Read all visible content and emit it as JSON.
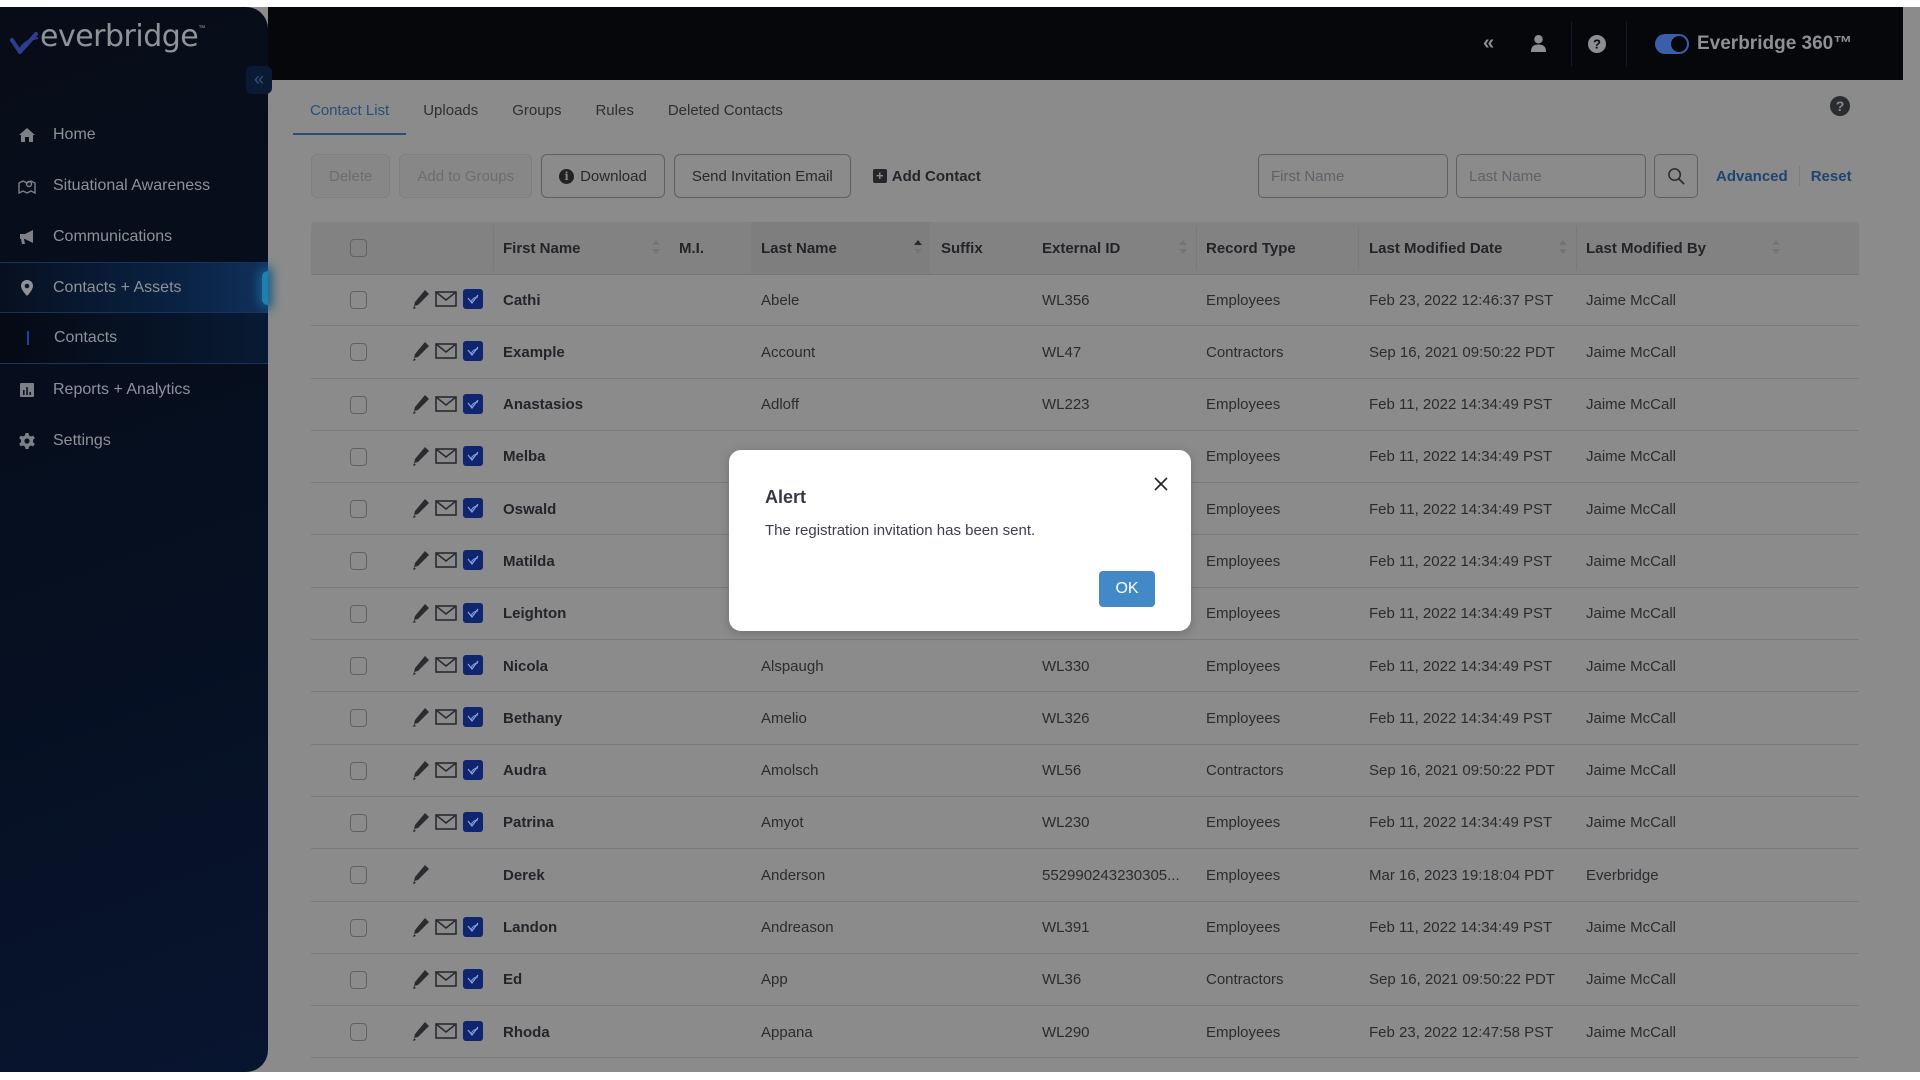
{
  "app": {
    "logo_text": "everbridge",
    "logo_tm": "™",
    "product_label": "Everbridge 360™",
    "product_toggle_on": true,
    "colors": {
      "accent": "#4389c7",
      "link": "#1f4472",
      "app_badge": "#0f2570",
      "toggle": "#3a5fa8"
    }
  },
  "sidebar": {
    "collapse_glyph": "«",
    "items": [
      {
        "label": "Home",
        "icon": "home-icon"
      },
      {
        "label": "Situational Awareness",
        "icon": "map-pin-icon"
      },
      {
        "label": "Communications",
        "icon": "megaphone-icon"
      },
      {
        "label": "Contacts + Assets",
        "icon": "location-icon",
        "active": true
      },
      {
        "label": "Contacts",
        "sub": true,
        "selected": true
      },
      {
        "label": "Reports + Analytics",
        "icon": "bar-chart-icon"
      },
      {
        "label": "Settings",
        "icon": "gear-icon"
      }
    ]
  },
  "topbar": {
    "collapse_glyph": "«",
    "user_icon": "user-icon",
    "help_icon": "help-icon"
  },
  "tabs": [
    {
      "label": "Contact List",
      "active": true
    },
    {
      "label": "Uploads"
    },
    {
      "label": "Groups"
    },
    {
      "label": "Rules"
    },
    {
      "label": "Deleted Contacts"
    }
  ],
  "toolbar": {
    "delete": "Delete",
    "add_to_groups": "Add to Groups",
    "download": "Download",
    "send_invitation": "Send Invitation Email",
    "add_contact": "Add Contact"
  },
  "search": {
    "first_name_placeholder": "First Name",
    "first_name_value": "",
    "last_name_placeholder": "Last Name",
    "last_name_value": "",
    "advanced": "Advanced",
    "reset": "Reset"
  },
  "table": {
    "columns": [
      "First Name",
      "M.I.",
      "Last Name",
      "Suffix",
      "External ID",
      "Record Type",
      "Last Modified Date",
      "Last Modified By"
    ],
    "sort": {
      "column": "Last Name",
      "direction": "asc"
    },
    "rows": [
      {
        "first": "Cathi",
        "mi": "",
        "last": "Abele",
        "suffix": "",
        "ext_id": "WL356",
        "type": "Employees",
        "modified": "Feb 23, 2022 12:46:37 PST",
        "by": "Jaime McCall",
        "icons": [
          "edit",
          "email",
          "app"
        ]
      },
      {
        "first": "Example",
        "mi": "",
        "last": "Account",
        "suffix": "",
        "ext_id": "WL47",
        "type": "Contractors",
        "modified": "Sep 16, 2021 09:50:22 PDT",
        "by": "Jaime McCall",
        "icons": [
          "edit",
          "email",
          "app"
        ]
      },
      {
        "first": "Anastasios",
        "mi": "",
        "last": "Adloff",
        "suffix": "",
        "ext_id": "WL223",
        "type": "Employees",
        "modified": "Feb 11, 2022 14:34:49 PST",
        "by": "Jaime McCall",
        "icons": [
          "edit",
          "email",
          "app"
        ]
      },
      {
        "first": "Melba",
        "mi": "",
        "last": "",
        "suffix": "",
        "ext_id": "",
        "type": "Employees",
        "modified": "Feb 11, 2022 14:34:49 PST",
        "by": "Jaime McCall",
        "icons": [
          "edit",
          "email",
          "app"
        ]
      },
      {
        "first": "Oswald",
        "mi": "",
        "last": "",
        "suffix": "",
        "ext_id": "",
        "type": "Employees",
        "modified": "Feb 11, 2022 14:34:49 PST",
        "by": "Jaime McCall",
        "icons": [
          "edit",
          "email",
          "app"
        ]
      },
      {
        "first": "Matilda",
        "mi": "",
        "last": "",
        "suffix": "",
        "ext_id": "",
        "type": "Employees",
        "modified": "Feb 11, 2022 14:34:49 PST",
        "by": "Jaime McCall",
        "icons": [
          "edit",
          "email",
          "app"
        ]
      },
      {
        "first": "Leighton",
        "mi": "",
        "last": "",
        "suffix": "",
        "ext_id": "",
        "type": "Employees",
        "modified": "Feb 11, 2022 14:34:49 PST",
        "by": "Jaime McCall",
        "icons": [
          "edit",
          "email",
          "app"
        ]
      },
      {
        "first": "Nicola",
        "mi": "",
        "last": "Alspaugh",
        "suffix": "",
        "ext_id": "WL330",
        "type": "Employees",
        "modified": "Feb 11, 2022 14:34:49 PST",
        "by": "Jaime McCall",
        "icons": [
          "edit",
          "email",
          "app"
        ]
      },
      {
        "first": "Bethany",
        "mi": "",
        "last": "Amelio",
        "suffix": "",
        "ext_id": "WL326",
        "type": "Employees",
        "modified": "Feb 11, 2022 14:34:49 PST",
        "by": "Jaime McCall",
        "icons": [
          "edit",
          "email",
          "app"
        ]
      },
      {
        "first": "Audra",
        "mi": "",
        "last": "Amolsch",
        "suffix": "",
        "ext_id": "WL56",
        "type": "Contractors",
        "modified": "Sep 16, 2021 09:50:22 PDT",
        "by": "Jaime McCall",
        "icons": [
          "edit",
          "email",
          "app"
        ]
      },
      {
        "first": "Patrina",
        "mi": "",
        "last": "Amyot",
        "suffix": "",
        "ext_id": "WL230",
        "type": "Employees",
        "modified": "Feb 11, 2022 14:34:49 PST",
        "by": "Jaime McCall",
        "icons": [
          "edit",
          "email",
          "app"
        ]
      },
      {
        "first": "Derek",
        "mi": "",
        "last": "Anderson",
        "suffix": "",
        "ext_id": "552990243230305...",
        "type": "Employees",
        "modified": "Mar 16, 2023 19:18:04 PDT",
        "by": "Everbridge",
        "icons": [
          "edit"
        ]
      },
      {
        "first": "Landon",
        "mi": "",
        "last": "Andreason",
        "suffix": "",
        "ext_id": "WL391",
        "type": "Employees",
        "modified": "Feb 11, 2022 14:34:49 PST",
        "by": "Jaime McCall",
        "icons": [
          "edit",
          "email",
          "app"
        ]
      },
      {
        "first": "Ed",
        "mi": "",
        "last": "App",
        "suffix": "",
        "ext_id": "WL36",
        "type": "Contractors",
        "modified": "Sep 16, 2021 09:50:22 PDT",
        "by": "Jaime McCall",
        "icons": [
          "edit",
          "email",
          "app"
        ]
      },
      {
        "first": "Rhoda",
        "mi": "",
        "last": "Appana",
        "suffix": "",
        "ext_id": "WL290",
        "type": "Employees",
        "modified": "Feb 23, 2022 12:47:58 PST",
        "by": "Jaime McCall",
        "icons": [
          "edit",
          "email",
          "app"
        ]
      }
    ]
  },
  "modal": {
    "title": "Alert",
    "message": "The registration invitation has been sent.",
    "ok": "OK"
  }
}
